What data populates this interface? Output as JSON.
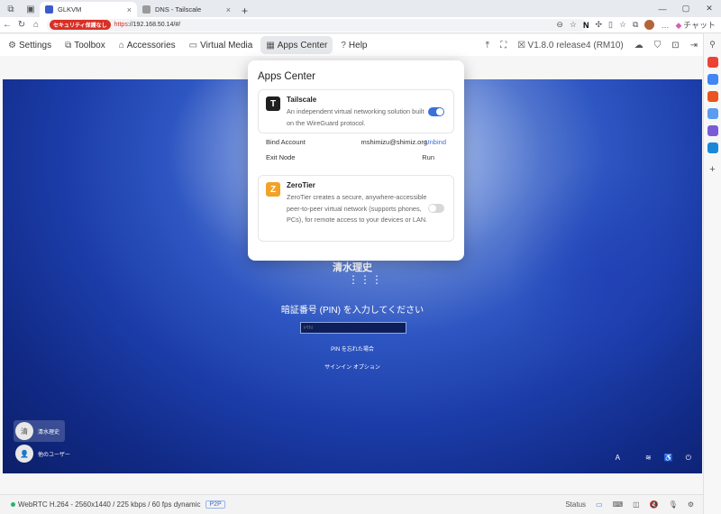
{
  "browser": {
    "tabs": [
      {
        "label": "GLKVM",
        "active": true,
        "close": "×"
      },
      {
        "label": "DNS - Tailscale",
        "active": false,
        "close": "×"
      }
    ],
    "newtab": "+",
    "window_controls": [
      "—",
      "▢",
      "✕"
    ],
    "security_badge": "セキュリティ保護なし",
    "url_scheme": "https",
    "url_rest": "://192.168.50.14/#/",
    "copilot_label": "チャット"
  },
  "kvm_menu": {
    "items": [
      {
        "label": "Settings",
        "icon": "gear-icon",
        "glyph": "⚙"
      },
      {
        "label": "Toolbox",
        "icon": "toolbox-icon",
        "glyph": "⧉"
      },
      {
        "label": "Accessories",
        "icon": "lock-icon",
        "glyph": "⌂"
      },
      {
        "label": "Virtual Media",
        "icon": "disk-icon",
        "glyph": "▭"
      },
      {
        "label": "Apps Center",
        "icon": "grid-icon",
        "glyph": "▦"
      },
      {
        "label": "Help",
        "icon": "help-icon",
        "glyph": "?"
      }
    ],
    "version": "V1.8.0 release4 (RM10)"
  },
  "apps_center": {
    "title": "Apps Center",
    "apps": [
      {
        "name": "Tailscale",
        "logo": "T",
        "logo_color": "#1f1f1f",
        "description": "An independent virtual networking solution built on the WireGuard protocol.",
        "enabled": true
      },
      {
        "name": "ZeroTier",
        "logo": "Z",
        "logo_color": "#f0a326",
        "description": "ZeroTier creates a secure, anywhere-accessible peer-to-peer virtual network (supports phones, PCs), for remote access to your devices or LAN.",
        "enabled": false
      }
    ],
    "bind_account": {
      "label": "Bind Account",
      "value": "mshimizu@shimiz.org",
      "action": "Unbind"
    },
    "exit_node": {
      "label": "Exit Node",
      "value": "Run"
    }
  },
  "lock_screen": {
    "user_name": "清水理史",
    "dots": "⋮⋮⋮",
    "pin_prompt": "暗証番号 (PIN) を入力してください",
    "pin_placeholder": "PIN",
    "forgot_pin": "PIN を忘れた場合",
    "signin_options": "サインイン オプション",
    "users": [
      {
        "name": "清水理史",
        "avatar": "清"
      },
      {
        "name": "他のユーザー",
        "avatar": "👤"
      }
    ],
    "tray_items": [
      "A",
      "≋",
      "♿",
      "⏻"
    ]
  },
  "status_bar": {
    "stream_info": "WebRTC H.264 - 2560x1440 / 225 kbps / 60 fps dynamic",
    "p2p": "P2P",
    "status_label": "Status"
  },
  "colors": {
    "accent": "#3b6fd9",
    "connected": "#29b36b",
    "insecure": "#d93025"
  }
}
